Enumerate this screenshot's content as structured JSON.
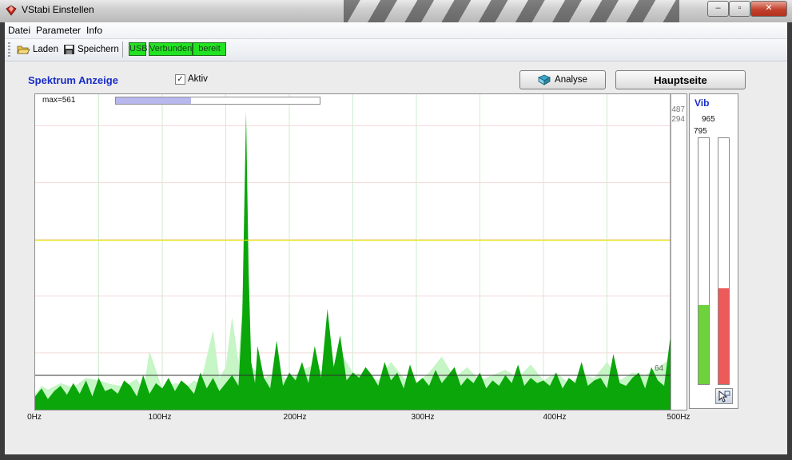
{
  "window": {
    "title": "VStabi Einstellen",
    "minimize": "–",
    "maximize": "▫",
    "close": "✕"
  },
  "menu": {
    "items": [
      "Datei",
      "Parameter",
      "Info"
    ]
  },
  "toolbar": {
    "laden": "Laden",
    "speichern": "Speichern",
    "status": {
      "usb": "USB",
      "verbunden": "Verbunden",
      "bereit": "bereit"
    },
    "status_color": "#22e322"
  },
  "panel": {
    "title": "Spektrum Anzeige",
    "aktiv_label": "Aktiv",
    "aktiv_checked": true,
    "analyse_button": "Analyse",
    "hauptseite_button": "Hauptseite"
  },
  "spectrum": {
    "max_label": "max=561",
    "progress_fraction": 0.37,
    "right_label_1": "487",
    "right_label_2": "294",
    "threshold_label": "64",
    "chart_data": {
      "type": "area",
      "title": "",
      "xlabel": "",
      "ylabel": "",
      "x_tick_labels": [
        "0Hz",
        "100Hz",
        "200Hz",
        "300Hz",
        "400Hz",
        "500Hz"
      ],
      "xlim": [
        0,
        500
      ],
      "ylim": [
        0,
        561
      ],
      "grid": true,
      "series": [
        {
          "color": "#c6f5c6",
          "x": [
            0,
            5,
            10,
            20,
            30,
            40,
            50,
            60,
            70,
            80,
            85,
            90,
            100,
            110,
            120,
            125,
            130,
            140,
            145,
            150,
            155,
            160,
            163,
            166,
            170,
            180,
            190,
            200,
            210,
            220,
            230,
            240,
            250,
            260,
            270,
            280,
            290,
            300,
            310,
            320,
            330,
            340,
            350,
            360,
            370,
            380,
            390,
            400,
            410,
            420,
            430,
            440,
            450,
            460,
            470,
            480,
            490,
            500
          ],
          "values": [
            30,
            45,
            38,
            50,
            42,
            60,
            55,
            48,
            44,
            58,
            35,
            110,
            40,
            50,
            45,
            55,
            48,
            150,
            60,
            80,
            175,
            90,
            200,
            120,
            80,
            60,
            70,
            55,
            75,
            85,
            60,
            110,
            70,
            65,
            55,
            90,
            60,
            50,
            70,
            100,
            60,
            80,
            55,
            65,
            75,
            60,
            85,
            55,
            70,
            50,
            65,
            60,
            90,
            55,
            70,
            65,
            80,
            95
          ]
        },
        {
          "color": "#0aa60a",
          "x": [
            0,
            5,
            10,
            15,
            20,
            25,
            30,
            35,
            40,
            45,
            50,
            55,
            60,
            65,
            70,
            75,
            80,
            85,
            90,
            95,
            100,
            105,
            110,
            115,
            120,
            125,
            130,
            135,
            140,
            145,
            150,
            155,
            160,
            163,
            166,
            168,
            170,
            173,
            175,
            180,
            185,
            190,
            195,
            200,
            205,
            210,
            215,
            220,
            225,
            230,
            235,
            240,
            245,
            250,
            255,
            260,
            265,
            270,
            275,
            280,
            285,
            290,
            295,
            300,
            305,
            310,
            315,
            320,
            325,
            330,
            335,
            340,
            345,
            350,
            355,
            360,
            365,
            370,
            375,
            380,
            385,
            390,
            395,
            400,
            405,
            410,
            415,
            420,
            425,
            430,
            435,
            440,
            445,
            450,
            455,
            460,
            465,
            470,
            475,
            480,
            485,
            490,
            495,
            500
          ],
          "values": [
            25,
            40,
            20,
            35,
            45,
            28,
            50,
            30,
            55,
            25,
            60,
            35,
            40,
            30,
            55,
            45,
            25,
            65,
            30,
            50,
            40,
            60,
            35,
            55,
            45,
            30,
            70,
            40,
            60,
            35,
            50,
            65,
            45,
            180,
            561,
            260,
            90,
            50,
            120,
            60,
            40,
            130,
            45,
            70,
            55,
            90,
            50,
            120,
            60,
            190,
            80,
            140,
            55,
            70,
            60,
            80,
            65,
            45,
            90,
            55,
            70,
            40,
            85,
            50,
            60,
            45,
            75,
            50,
            65,
            80,
            45,
            60,
            50,
            70,
            40,
            55,
            45,
            65,
            50,
            85,
            45,
            60,
            50,
            55,
            45,
            70,
            40,
            60,
            50,
            90,
            45,
            55,
            60,
            40,
            105,
            50,
            45,
            60,
            70,
            40,
            80,
            55,
            45,
            140
          ]
        }
      ]
    }
  },
  "vib": {
    "title": "Vib",
    "top_value": "965",
    "left_value": "795",
    "left_fraction": 0.32,
    "right_fraction": 0.39,
    "left_color": "#6ed23c",
    "right_color": "#ec5a5a"
  }
}
